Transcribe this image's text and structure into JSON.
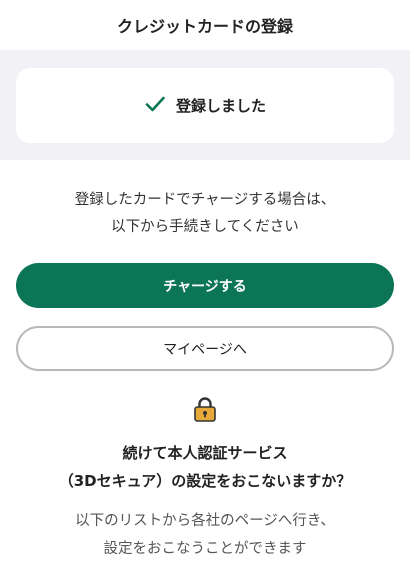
{
  "header": {
    "title": "クレジットカードの登録"
  },
  "success": {
    "icon": "check-icon",
    "message": "登録しました",
    "accent": "#0b7556"
  },
  "info": {
    "line1": "登録したカードでチャージする場合は、",
    "line2": "以下から手続きしてください"
  },
  "buttons": {
    "charge_label": "チャージする",
    "mypage_label": "マイページへ",
    "primary_color": "#0b7556"
  },
  "verification": {
    "icon": "lock-icon",
    "question_line1": "続けて本人認証サービス",
    "question_line2": "（3Dセキュア）の設定をおこないますか？",
    "note_line1": "以下のリストから各社のページへ行き、",
    "note_line2": "設定をおこなうことができます"
  }
}
